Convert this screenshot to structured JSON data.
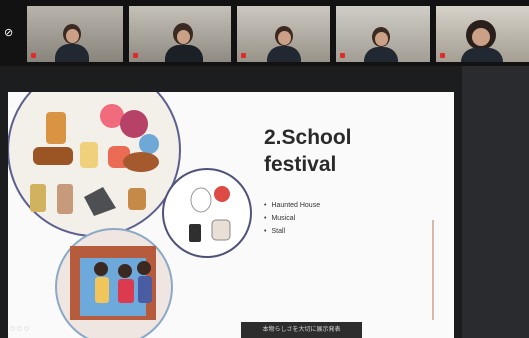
{
  "participants": [
    {
      "name": "",
      "active": false
    },
    {
      "name": "",
      "active": true
    },
    {
      "name": "",
      "active": false
    },
    {
      "name": "",
      "active": false
    },
    {
      "name": "",
      "active": false
    }
  ],
  "slide": {
    "title_line1": "2.School",
    "title_line2": "festival",
    "bullets": [
      "Haunted House",
      "Musical",
      "Stall"
    ],
    "caption": "本物らしさを大切に展示発表"
  },
  "icons": {
    "mute": "mic-muted-icon",
    "speaker": "active-speaker-border"
  },
  "colors": {
    "active_border": "#2ec26a",
    "muted": "#e02b2b",
    "background": "#1c1d1f"
  }
}
